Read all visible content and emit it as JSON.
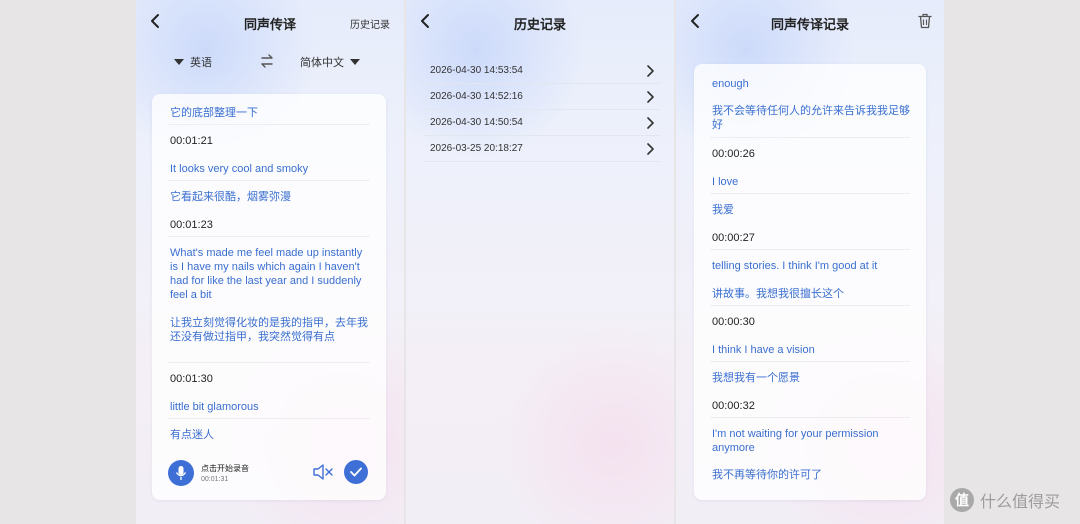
{
  "screen1": {
    "title": "同声传译",
    "history_link": "历史记录",
    "source_lang": "英语",
    "target_lang": "简体中文",
    "transcript": [
      {
        "text": "它的底部整理一下",
        "kind": "zh"
      },
      {
        "text": "00:01:21",
        "kind": "time"
      },
      {
        "text": "It looks very cool and smoky",
        "kind": "en"
      },
      {
        "text": "它看起来很酷，烟雾弥漫",
        "kind": "zh"
      },
      {
        "text": "00:01:23",
        "kind": "time"
      },
      {
        "text": "What's made me feel made up instantly is I have my nails which again I haven't had for like the last year and I suddenly feel a bit",
        "kind": "en"
      },
      {
        "text": "让我立刻觉得化妆的是我的指甲，去年我还没有做过指甲，我突然觉得有点",
        "kind": "zh"
      },
      {
        "text": "00:01:30",
        "kind": "time"
      },
      {
        "text": "little bit glamorous",
        "kind": "en"
      },
      {
        "text": "有点迷人",
        "kind": "zh"
      }
    ],
    "record_label": "点击开始录音",
    "record_time": "00:01:31"
  },
  "screen2": {
    "title": "历史记录",
    "records": [
      "2026-04-30 14:53:54",
      "2026-04-30 14:52:16",
      "2026-04-30 14:50:54",
      "2026-03-25 20:18:27"
    ]
  },
  "screen3": {
    "title": "同声传译记录",
    "transcript": [
      {
        "text": "enough",
        "kind": "en"
      },
      {
        "text": "我不会等待任何人的允许来告诉我我足够好",
        "kind": "zh"
      },
      {
        "text": "00:00:26",
        "kind": "time"
      },
      {
        "text": "I love",
        "kind": "en"
      },
      {
        "text": "我爱",
        "kind": "zh"
      },
      {
        "text": "00:00:27",
        "kind": "time"
      },
      {
        "text": "telling stories. I think I'm good at it",
        "kind": "en"
      },
      {
        "text": "讲故事。我想我很擅长这个",
        "kind": "zh"
      },
      {
        "text": "00:00:30",
        "kind": "time"
      },
      {
        "text": "I think I have a vision",
        "kind": "en"
      },
      {
        "text": "我想我有一个愿景",
        "kind": "zh"
      },
      {
        "text": "00:00:32",
        "kind": "time"
      },
      {
        "text": "I'm not waiting for your permission anymore",
        "kind": "en"
      },
      {
        "text": "我不再等待你的许可了",
        "kind": "zh"
      }
    ]
  },
  "watermark": {
    "logo_char": "值",
    "text": "什么值得买"
  },
  "colors": {
    "accent": "#3d6fd6",
    "transcript_text": "#3a6fd0"
  }
}
